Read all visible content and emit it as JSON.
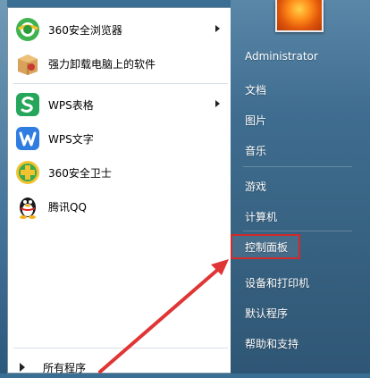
{
  "programs": [
    {
      "label": "360安全浏览器",
      "icon": "360-browser-icon",
      "has_submenu": true
    },
    {
      "label": "强力卸载电脑上的软件",
      "icon": "uninstall-box-icon",
      "has_submenu": false
    },
    {
      "label": "WPS表格",
      "icon": "wps-spreadsheet-icon",
      "has_submenu": true
    },
    {
      "label": "WPS文字",
      "icon": "wps-writer-icon",
      "has_submenu": false
    },
    {
      "label": "360安全卫士",
      "icon": "360-guard-icon",
      "has_submenu": false
    },
    {
      "label": "腾讯QQ",
      "icon": "qq-penguin-icon",
      "has_submenu": false
    }
  ],
  "all_programs": {
    "label": "所有程序"
  },
  "right_menu": [
    {
      "label": "Administrator"
    },
    {
      "label": "文档"
    },
    {
      "label": "图片"
    },
    {
      "label": "音乐"
    },
    {
      "label": "游戏"
    },
    {
      "label": "计算机"
    },
    {
      "label": "控制面板"
    },
    {
      "label": "设备和打印机"
    },
    {
      "label": "默认程序"
    },
    {
      "label": "帮助和支持"
    }
  ],
  "colors": {
    "highlight_border": "#d12a2a",
    "annotation_arrow": "#e03535"
  }
}
